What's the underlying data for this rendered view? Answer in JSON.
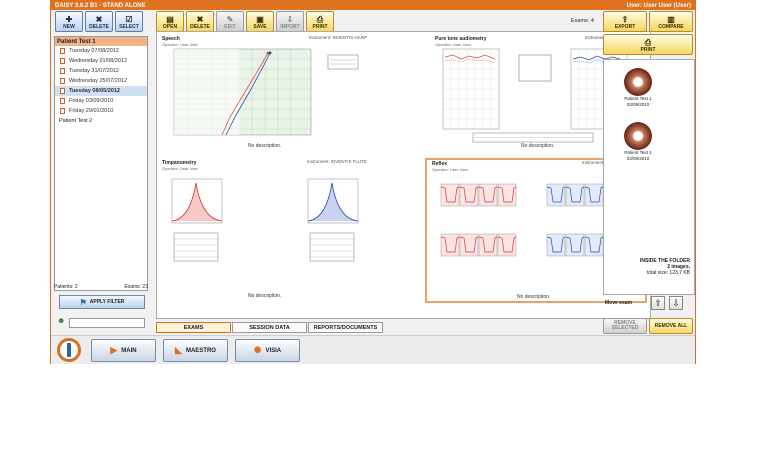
{
  "titlebar": {
    "title": "DAISY 3.6.2 B1 - STAND ALONE",
    "user": "User: User User (User)"
  },
  "toolbar_left": [
    {
      "label": "NEW",
      "icon": "new-icon"
    },
    {
      "label": "DELETE",
      "icon": "delete-icon"
    },
    {
      "label": "SELECT",
      "icon": "select-icon"
    }
  ],
  "toolbar_main": [
    {
      "label": "OPEN",
      "icon": "open-icon"
    },
    {
      "label": "DELETE",
      "icon": "delete-icon"
    },
    {
      "label": "EDIT",
      "icon": "edit-icon"
    },
    {
      "label": "SAVE",
      "icon": "save-icon"
    },
    {
      "label": "IMPORT",
      "icon": "import-icon"
    },
    {
      "label": "PRINT",
      "icon": "print-icon"
    }
  ],
  "exams_count": "Exams: 4",
  "patients": {
    "p1": "Patient Test 1",
    "exams": [
      "Tuesday 07/08/2012",
      "Wednesday 01/08/2012",
      "Tuesday 31/07/2012",
      "Wednesday 25/07/2012",
      "Tuesday 08/05/2012",
      "Friday 03/09/2010",
      "Friday 29/01/2010"
    ],
    "p2": "Patient Test 2"
  },
  "footer": {
    "patients": "Patients: 2",
    "exams": "Exams: 23",
    "filter": "APPLY FILTER"
  },
  "charts": {
    "speech": {
      "title": "Speech",
      "instrument": "Instrument: INVENTIS HARP",
      "operator": "Operator: User User",
      "nodesc": "No description."
    },
    "pta": {
      "title": "Pure tone audiometry",
      "instrument": "Instrument: INVENTIS HARP",
      "operator": "Operator: User User",
      "nodesc": "No description."
    },
    "tymp": {
      "title": "Timpanometry",
      "instrument": "Instrument: INVENTIS FLUTE",
      "operator": "Operator: User User",
      "nodesc": "No description."
    },
    "reflex": {
      "title": "Reflex",
      "instrument": "Instrument: INVENTIS FLUTE",
      "operator": "Operator: User User",
      "nodesc": "No description."
    }
  },
  "right": {
    "export": "EXPORT",
    "compare": "COMPARE",
    "print": "PRINT",
    "images": [
      {
        "name": "Patient Test 1",
        "date": "03/09/2010"
      },
      {
        "name": "Patient Test 1",
        "date": "03/09/2010"
      }
    ],
    "folder_title": "INSIDE THE FOLDER",
    "folder_count": "2 images,",
    "folder_size": "total size: 123,7 KB",
    "move": "Move exam",
    "remove_selected": "REMOVE SELECTED",
    "remove_all": "REMOVE ALL"
  },
  "tabs": [
    "EXAMS",
    "SESSION DATA",
    "REPORTS/DOCUMENTS"
  ],
  "nav": [
    "MAIN",
    "MAESTRO",
    "VISIA"
  ]
}
